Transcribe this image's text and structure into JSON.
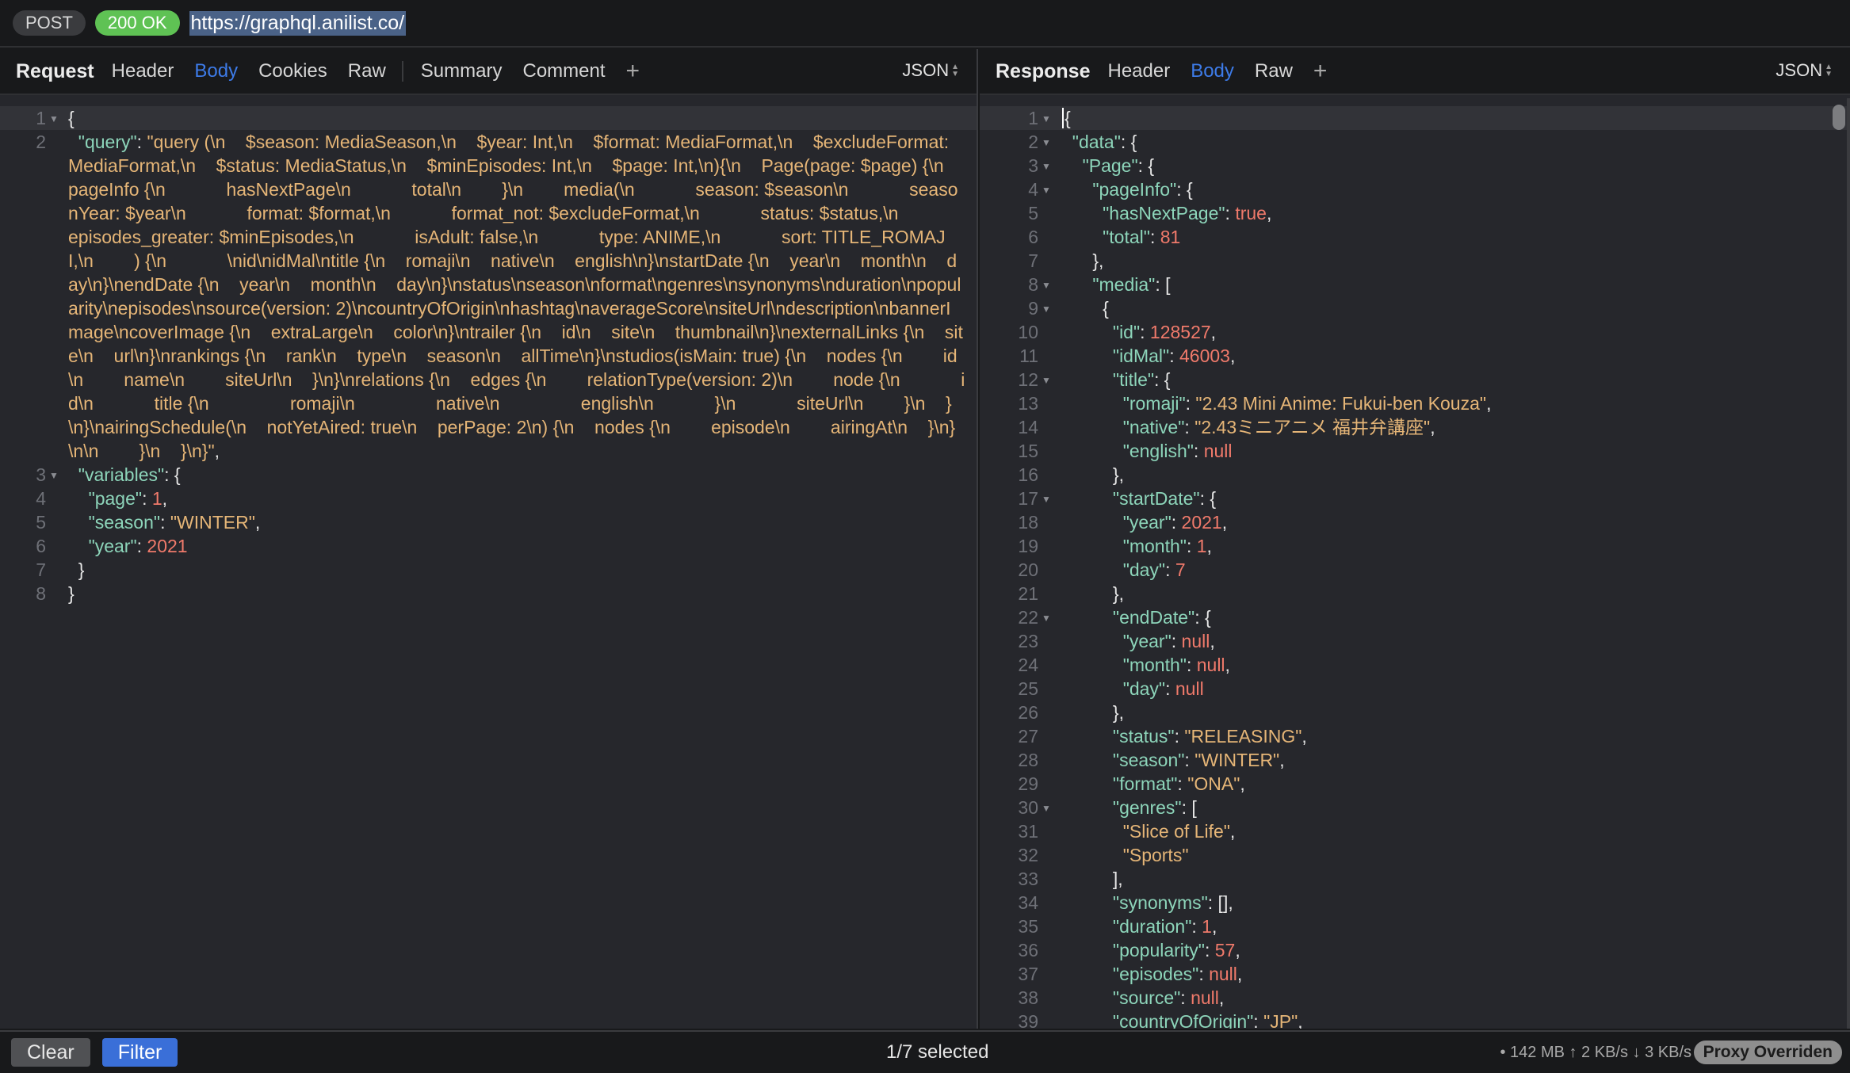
{
  "topbar": {
    "method": "POST",
    "status": "200 OK",
    "url": "https://graphql.anilist.co/"
  },
  "request": {
    "title": "Request",
    "tabs": [
      "Header",
      "Body",
      "Cookies",
      "Raw",
      "Summary",
      "Comment"
    ],
    "active_tab": "Body",
    "format": "JSON",
    "lines": [
      {
        "n": "1",
        "fold": true,
        "html": "<span class=\"p\">{</span>"
      },
      {
        "n": "2",
        "fold": false,
        "html": "  <span class=\"k\">\"query\"</span><span class=\"p\">: </span><span class=\"s\">\"query (\\n    $season: MediaSeason,\\n    $year: Int,\\n    $format: MediaFormat,\\n    $excludeFormat: MediaFormat,\\n    $status: MediaStatus,\\n    $minEpisodes: Int,\\n    $page: Int,\\n){\\n    Page(page: $page) {\\n        pageInfo {\\n            hasNextPage\\n            total\\n        }\\n        media(\\n            season: $season\\n            seasonYear: $year\\n            format: $format,\\n            format_not: $excludeFormat,\\n            status: $status,\\n            episodes_greater: $minEpisodes,\\n            isAdult: false,\\n            type: ANIME,\\n            sort: TITLE_ROMAJI,\\n        ) {\\n            \\nid\\nidMal\\ntitle {\\n    romaji\\n    native\\n    english\\n}\\nstartDate {\\n    year\\n    month\\n    day\\n}\\nendDate {\\n    year\\n    month\\n    day\\n}\\nstatus\\nseason\\nformat\\ngenres\\nsynonyms\\nduration\\npopularity\\nepisodes\\nsource(version: 2)\\ncountryOfOrigin\\nhashtag\\naverageScore\\nsiteUrl\\ndescription\\nbannerImage\\ncoverImage {\\n    extraLarge\\n    color\\n}\\ntrailer {\\n    id\\n    site\\n    thumbnail\\n}\\nexternalLinks {\\n    site\\n    url\\n}\\nrankings {\\n    rank\\n    type\\n    season\\n    allTime\\n}\\nstudios(isMain: true) {\\n    nodes {\\n        id\\n        name\\n        siteUrl\\n    }\\n}\\nrelations {\\n    edges {\\n        relationType(version: 2)\\n        node {\\n            id\\n            title {\\n                romaji\\n                native\\n                english\\n            }\\n            siteUrl\\n        }\\n    }\\n}\\nairingSchedule(\\n    notYetAired: true\\n    perPage: 2\\n) {\\n    nodes {\\n        episode\\n        airingAt\\n    }\\n}\\n\\n        }\\n    }\\n}\"</span><span class=\"p\">,</span>",
        "wrap": true
      },
      {
        "n": "3",
        "fold": true,
        "html": "  <span class=\"k\">\"variables\"</span><span class=\"p\">: {</span>"
      },
      {
        "n": "4",
        "fold": false,
        "html": "    <span class=\"k\">\"page\"</span><span class=\"p\">: </span><span class=\"n\">1</span><span class=\"p\">,</span>"
      },
      {
        "n": "5",
        "fold": false,
        "html": "    <span class=\"k\">\"season\"</span><span class=\"p\">: </span><span class=\"s\">\"WINTER\"</span><span class=\"p\">,</span>"
      },
      {
        "n": "6",
        "fold": false,
        "html": "    <span class=\"k\">\"year\"</span><span class=\"p\">: </span><span class=\"n\">2021</span>"
      },
      {
        "n": "7",
        "fold": false,
        "html": "  <span class=\"p\">}</span>"
      },
      {
        "n": "8",
        "fold": false,
        "html": "<span class=\"p\">}</span>"
      }
    ]
  },
  "response": {
    "title": "Response",
    "tabs": [
      "Header",
      "Body",
      "Raw"
    ],
    "active_tab": "Body",
    "format": "JSON",
    "lines": [
      {
        "n": "1",
        "fold": true,
        "html": "<span class=\"caret\"></span><span class=\"p\">{</span>",
        "current": true
      },
      {
        "n": "2",
        "fold": true,
        "html": "  <span class=\"k\">\"data\"</span><span class=\"p\">: {</span>"
      },
      {
        "n": "3",
        "fold": true,
        "html": "    <span class=\"k\">\"Page\"</span><span class=\"p\">: {</span>"
      },
      {
        "n": "4",
        "fold": true,
        "html": "      <span class=\"k\">\"pageInfo\"</span><span class=\"p\">: {</span>"
      },
      {
        "n": "5",
        "fold": false,
        "html": "        <span class=\"k\">\"hasNextPage\"</span><span class=\"p\">: </span><span class=\"n\">true</span><span class=\"p\">,</span>"
      },
      {
        "n": "6",
        "fold": false,
        "html": "        <span class=\"k\">\"total\"</span><span class=\"p\">: </span><span class=\"n\">81</span>"
      },
      {
        "n": "7",
        "fold": false,
        "html": "      <span class=\"p\">},</span>"
      },
      {
        "n": "8",
        "fold": true,
        "html": "      <span class=\"k\">\"media\"</span><span class=\"p\">: [</span>"
      },
      {
        "n": "9",
        "fold": true,
        "html": "        <span class=\"p\">{</span>"
      },
      {
        "n": "10",
        "fold": false,
        "html": "          <span class=\"k\">\"id\"</span><span class=\"p\">: </span><span class=\"n\">128527</span><span class=\"p\">,</span>"
      },
      {
        "n": "11",
        "fold": false,
        "html": "          <span class=\"k\">\"idMal\"</span><span class=\"p\">: </span><span class=\"n\">46003</span><span class=\"p\">,</span>"
      },
      {
        "n": "12",
        "fold": true,
        "html": "          <span class=\"k\">\"title\"</span><span class=\"p\">: {</span>"
      },
      {
        "n": "13",
        "fold": false,
        "html": "            <span class=\"k\">\"romaji\"</span><span class=\"p\">: </span><span class=\"s\">\"2.43 Mini Anime: Fukui-ben Kouza\"</span><span class=\"p\">,</span>"
      },
      {
        "n": "14",
        "fold": false,
        "html": "            <span class=\"k\">\"native\"</span><span class=\"p\">: </span><span class=\"s\">\"2.43ミニアニメ 福井弁講座\"</span><span class=\"p\">,</span>"
      },
      {
        "n": "15",
        "fold": false,
        "html": "            <span class=\"k\">\"english\"</span><span class=\"p\">: </span><span class=\"n\">null</span>"
      },
      {
        "n": "16",
        "fold": false,
        "html": "          <span class=\"p\">},</span>"
      },
      {
        "n": "17",
        "fold": true,
        "html": "          <span class=\"k\">\"startDate\"</span><span class=\"p\">: {</span>"
      },
      {
        "n": "18",
        "fold": false,
        "html": "            <span class=\"k\">\"year\"</span><span class=\"p\">: </span><span class=\"n\">2021</span><span class=\"p\">,</span>"
      },
      {
        "n": "19",
        "fold": false,
        "html": "            <span class=\"k\">\"month\"</span><span class=\"p\">: </span><span class=\"n\">1</span><span class=\"p\">,</span>"
      },
      {
        "n": "20",
        "fold": false,
        "html": "            <span class=\"k\">\"day\"</span><span class=\"p\">: </span><span class=\"n\">7</span>"
      },
      {
        "n": "21",
        "fold": false,
        "html": "          <span class=\"p\">},</span>"
      },
      {
        "n": "22",
        "fold": true,
        "html": "          <span class=\"k\">\"endDate\"</span><span class=\"p\">: {</span>"
      },
      {
        "n": "23",
        "fold": false,
        "html": "            <span class=\"k\">\"year\"</span><span class=\"p\">: </span><span class=\"n\">null</span><span class=\"p\">,</span>"
      },
      {
        "n": "24",
        "fold": false,
        "html": "            <span class=\"k\">\"month\"</span><span class=\"p\">: </span><span class=\"n\">null</span><span class=\"p\">,</span>"
      },
      {
        "n": "25",
        "fold": false,
        "html": "            <span class=\"k\">\"day\"</span><span class=\"p\">: </span><span class=\"n\">null</span>"
      },
      {
        "n": "26",
        "fold": false,
        "html": "          <span class=\"p\">},</span>"
      },
      {
        "n": "27",
        "fold": false,
        "html": "          <span class=\"k\">\"status\"</span><span class=\"p\">: </span><span class=\"s\">\"RELEASING\"</span><span class=\"p\">,</span>"
      },
      {
        "n": "28",
        "fold": false,
        "html": "          <span class=\"k\">\"season\"</span><span class=\"p\">: </span><span class=\"s\">\"WINTER\"</span><span class=\"p\">,</span>"
      },
      {
        "n": "29",
        "fold": false,
        "html": "          <span class=\"k\">\"format\"</span><span class=\"p\">: </span><span class=\"s\">\"ONA\"</span><span class=\"p\">,</span>"
      },
      {
        "n": "30",
        "fold": true,
        "html": "          <span class=\"k\">\"genres\"</span><span class=\"p\">: [</span>"
      },
      {
        "n": "31",
        "fold": false,
        "html": "            <span class=\"s\">\"Slice of Life\"</span><span class=\"p\">,</span>"
      },
      {
        "n": "32",
        "fold": false,
        "html": "            <span class=\"s\">\"Sports\"</span>"
      },
      {
        "n": "33",
        "fold": false,
        "html": "          <span class=\"p\">],</span>"
      },
      {
        "n": "34",
        "fold": false,
        "html": "          <span class=\"k\">\"synonyms\"</span><span class=\"p\">: [],</span>"
      },
      {
        "n": "35",
        "fold": false,
        "html": "          <span class=\"k\">\"duration\"</span><span class=\"p\">: </span><span class=\"n\">1</span><span class=\"p\">,</span>"
      },
      {
        "n": "36",
        "fold": false,
        "html": "          <span class=\"k\">\"popularity\"</span><span class=\"p\">: </span><span class=\"n\">57</span><span class=\"p\">,</span>"
      },
      {
        "n": "37",
        "fold": false,
        "html": "          <span class=\"k\">\"episodes\"</span><span class=\"p\">: </span><span class=\"n\">null</span><span class=\"p\">,</span>"
      },
      {
        "n": "38",
        "fold": false,
        "html": "          <span class=\"k\">\"source\"</span><span class=\"p\">: </span><span class=\"n\">null</span><span class=\"p\">,</span>"
      },
      {
        "n": "39",
        "fold": false,
        "html": "          <span class=\"k\">\"countryOfOrigin\"</span><span class=\"p\">: </span><span class=\"s\">\"JP\"</span><span class=\"p\">,</span>"
      }
    ]
  },
  "bottombar": {
    "clear_label": "Clear",
    "filter_label": "Filter",
    "selection": "1/7 selected",
    "stats": "• 142 MB ↑ 2 KB/s ↓ 3 KB/s",
    "proxy_badge": "Proxy Overriden"
  },
  "colors": {
    "status_ok": "#5fc254",
    "accent_tab": "#3d7be8",
    "filter_button": "#3a6fd8",
    "json_key": "#8dd5ba",
    "json_string": "#e5b577",
    "json_number": "#f07a6b"
  }
}
